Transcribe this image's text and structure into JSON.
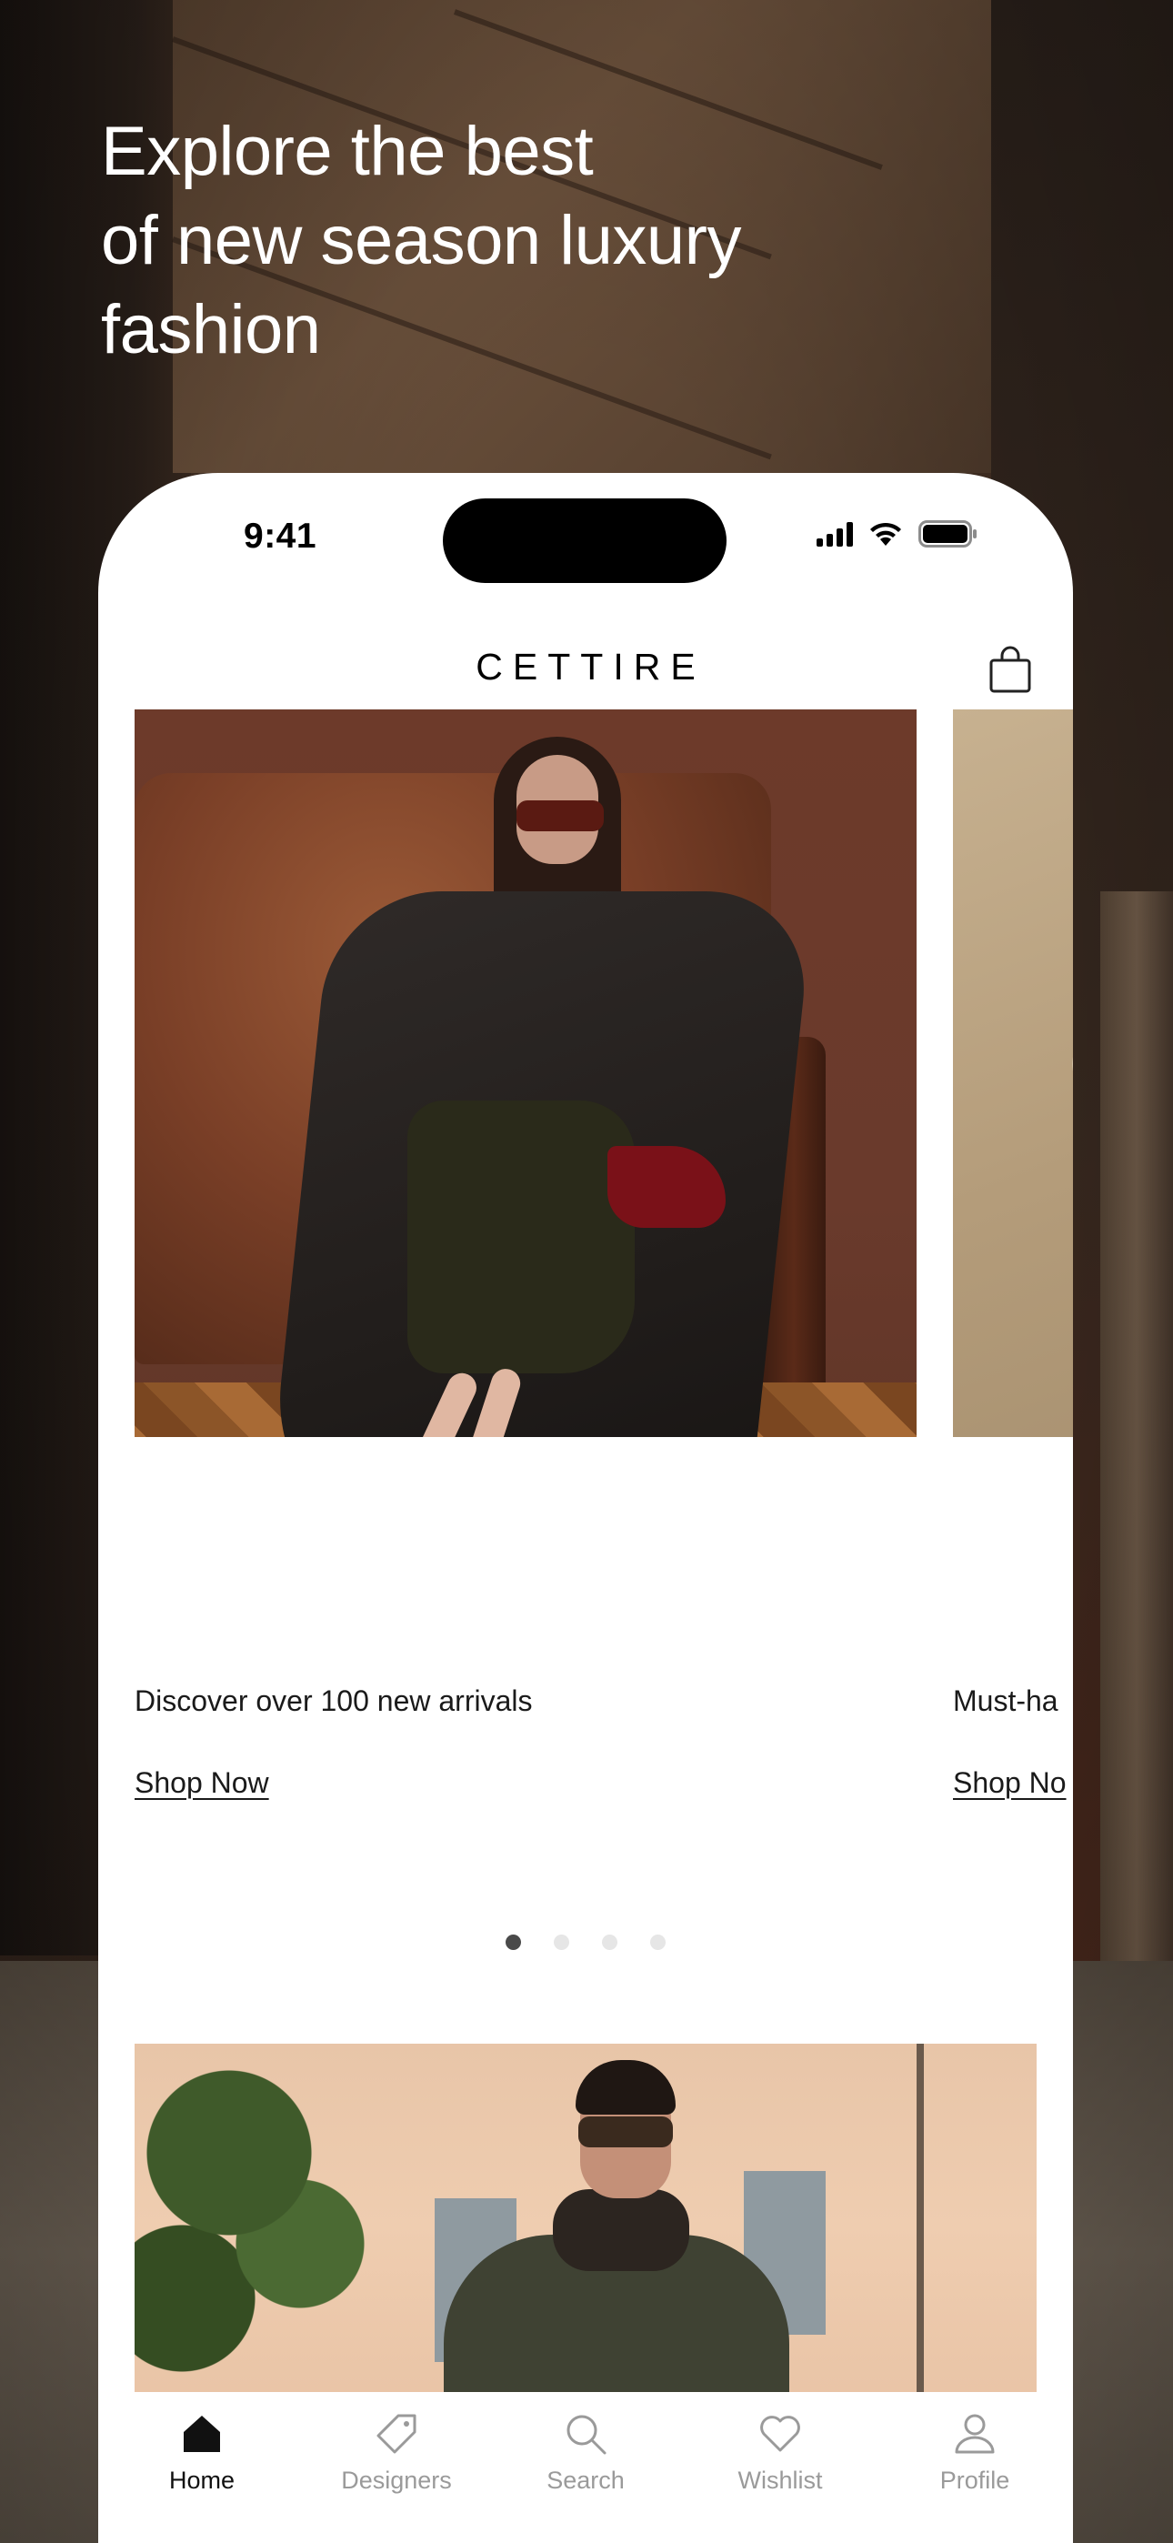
{
  "promo": {
    "headline_line1": "Explore the best",
    "headline_line2": "of new season luxury",
    "headline_line3": "fashion"
  },
  "status_bar": {
    "time": "9:41"
  },
  "header": {
    "logo": "CETTIRE",
    "bag_icon": "shopping-bag-icon"
  },
  "carousel": {
    "slides": [
      {
        "caption": "Discover over 100 new arrivals",
        "cta": "Shop Now"
      },
      {
        "caption": "Must-ha",
        "cta": "Shop No"
      }
    ],
    "page_count": 4,
    "active_index": 0
  },
  "tab_bar": {
    "items": [
      {
        "label": "Home",
        "icon": "home-icon",
        "active": true
      },
      {
        "label": "Designers",
        "icon": "tag-icon",
        "active": false
      },
      {
        "label": "Search",
        "icon": "search-icon",
        "active": false
      },
      {
        "label": "Wishlist",
        "icon": "heart-icon",
        "active": false
      },
      {
        "label": "Profile",
        "icon": "user-icon",
        "active": false
      }
    ]
  },
  "colors": {
    "text_primary": "#1a1a1a",
    "tab_inactive": "#9a9a9a",
    "dot_active": "#4a4a4a",
    "dot_inactive": "#e6e6e6"
  }
}
